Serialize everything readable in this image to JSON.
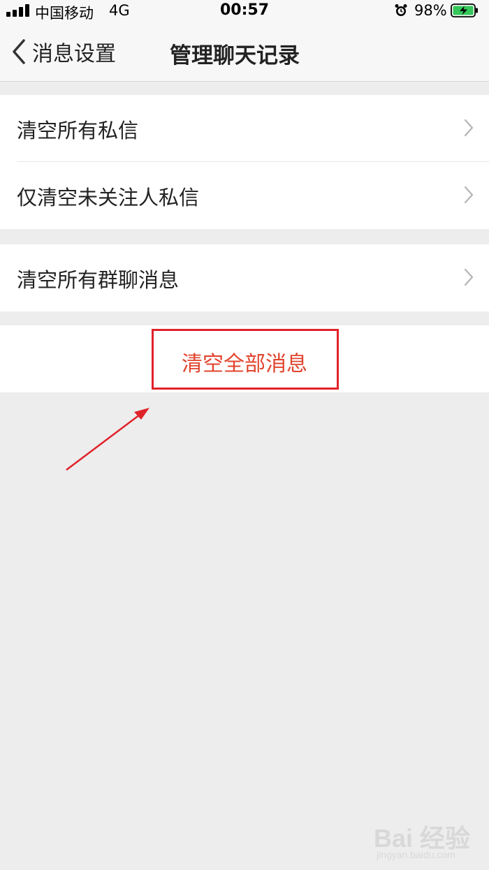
{
  "status_bar": {
    "carrier": "中国移动",
    "network": "4G",
    "time": "00:57",
    "battery_percent": "98%",
    "icons": [
      "signal-icon",
      "alarm-icon",
      "battery-charging-icon"
    ]
  },
  "nav": {
    "back_label": "消息设置",
    "title": "管理聊天记录"
  },
  "groups": [
    {
      "items": [
        {
          "label": "清空所有私信"
        },
        {
          "label": "仅清空未关注人私信"
        }
      ]
    },
    {
      "items": [
        {
          "label": "清空所有群聊消息"
        }
      ]
    }
  ],
  "danger_action": {
    "label": "清空全部消息"
  },
  "colors": {
    "accent_danger": "#e0442d",
    "annotation_red": "#e0222a",
    "background": "#ededed",
    "battery_green": "#34c759"
  },
  "watermark": {
    "brand": "Bai 经验",
    "url": "jingyan.baidu.com"
  }
}
